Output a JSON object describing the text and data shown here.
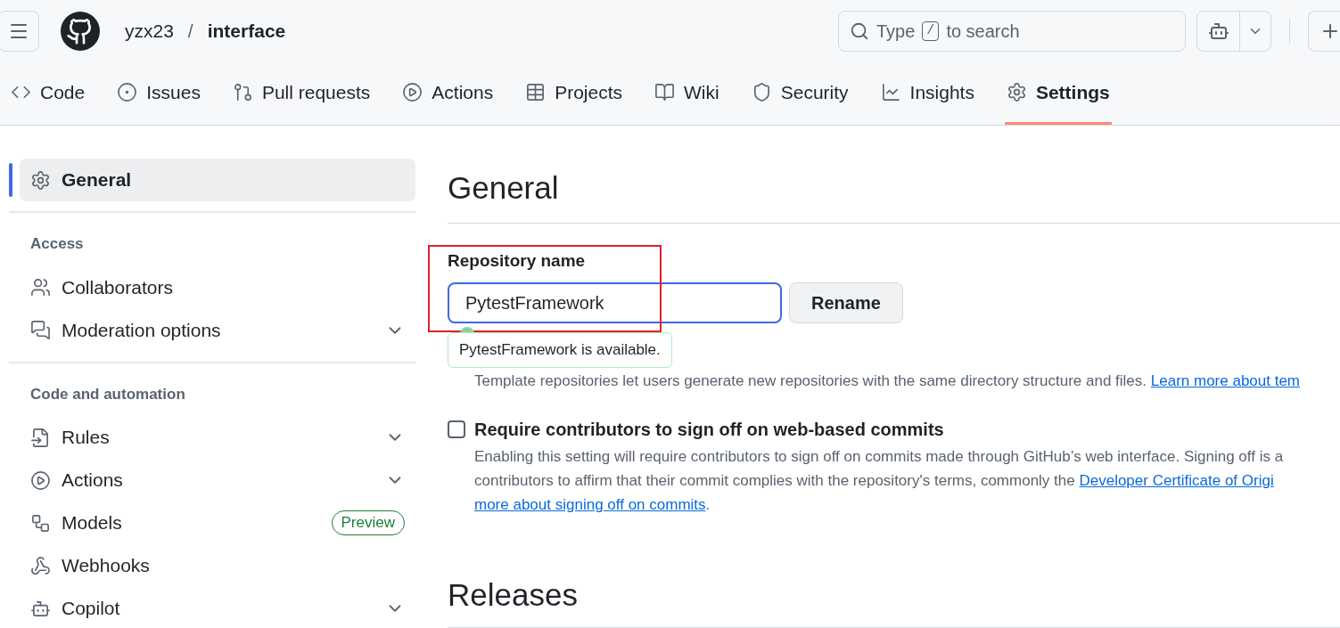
{
  "header": {
    "owner": "yzx23",
    "separator": "/",
    "repo": "interface",
    "search": {
      "before": "Type",
      "key": "/",
      "after": "to search"
    }
  },
  "tabs": [
    {
      "label": "Code",
      "selected": false
    },
    {
      "label": "Issues",
      "selected": false
    },
    {
      "label": "Pull requests",
      "selected": false
    },
    {
      "label": "Actions",
      "selected": false
    },
    {
      "label": "Projects",
      "selected": false
    },
    {
      "label": "Wiki",
      "selected": false
    },
    {
      "label": "Security",
      "selected": false
    },
    {
      "label": "Insights",
      "selected": false
    },
    {
      "label": "Settings",
      "selected": true
    }
  ],
  "sidebar": {
    "sections": [
      {
        "items": [
          {
            "label": "General",
            "selected": true,
            "expandable": false
          }
        ]
      },
      {
        "heading": "Access",
        "items": [
          {
            "label": "Collaborators",
            "selected": false,
            "expandable": false
          },
          {
            "label": "Moderation options",
            "selected": false,
            "expandable": true
          }
        ]
      },
      {
        "heading": "Code and automation",
        "items": [
          {
            "label": "Rules",
            "selected": false,
            "expandable": true
          },
          {
            "label": "Actions",
            "selected": false,
            "expandable": true
          },
          {
            "label": "Models",
            "selected": false,
            "expandable": false,
            "badge": "Preview"
          },
          {
            "label": "Webhooks",
            "selected": false,
            "expandable": false
          },
          {
            "label": "Copilot",
            "selected": false,
            "expandable": true
          }
        ]
      }
    ]
  },
  "main": {
    "title": "General",
    "repo_name": {
      "label": "Repository name",
      "value": "PytestFramework",
      "button": "Rename",
      "message": "PytestFramework is available."
    },
    "template_note": {
      "text": "Template repositories let users generate new repositories with the same directory structure and files.",
      "link": "Learn more about tem"
    },
    "signoff": {
      "label": "Require contributors to sign off on web-based commits",
      "checked": false,
      "line_1": "Enabling this setting will require contributors to sign off on commits made through GitHub’s web interface. Signing off is a",
      "line_2": "contributors to affirm that their commit complies with the repository's terms, commonly the",
      "line_2_link": "Developer Certificate of Origi",
      "line_3_link": "more about signing off on commits",
      "line_3_end": "."
    },
    "releases_title": "Releases"
  }
}
